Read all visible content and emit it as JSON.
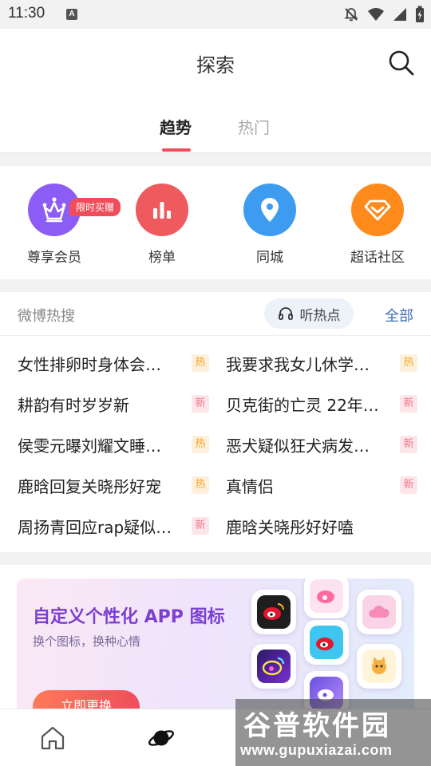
{
  "status_bar": {
    "time": "11:30",
    "notification_badge": "A",
    "icons": [
      "notifications-off-icon",
      "wifi-icon",
      "signal-icon",
      "battery-charging-icon"
    ]
  },
  "header": {
    "title": "探索",
    "search_icon": "search-icon"
  },
  "tabs": [
    {
      "label": "趋势",
      "active": true
    },
    {
      "label": "热门",
      "active": false
    }
  ],
  "quick_entries": [
    {
      "label": "尊享会员",
      "icon": "crown-icon",
      "color": "#8b5cf6",
      "badge": "限时买赠"
    },
    {
      "label": "榜单",
      "icon": "bar-chart-icon",
      "color": "#ef5a5f"
    },
    {
      "label": "同城",
      "icon": "location-pin-icon",
      "color": "#3d9cf0"
    },
    {
      "label": "超话社区",
      "icon": "diamond-icon",
      "color": "#ff8a1c"
    }
  ],
  "hot_search": {
    "title": "微博热搜",
    "listen_label": "听热点",
    "all_label": "全部",
    "items": [
      {
        "text": "女性排卵时身体会…",
        "tag": "热"
      },
      {
        "text": "我要求我女儿休学…",
        "tag": "热"
      },
      {
        "text": "耕韵有时岁岁新",
        "tag": "新"
      },
      {
        "text": "贝克街的亡灵 22年…",
        "tag": "新"
      },
      {
        "text": "侯雯元曝刘耀文睡…",
        "tag": "热"
      },
      {
        "text": "恶犬疑似狂犬病发…",
        "tag": "新"
      },
      {
        "text": "鹿晗回复关晓彤好宠",
        "tag": "热"
      },
      {
        "text": "真情侣",
        "tag": "新"
      },
      {
        "text": "周扬青回应rap疑似…",
        "tag": "新"
      },
      {
        "text": "鹿晗关晓彤好好嗑",
        "tag": ""
      }
    ]
  },
  "banner": {
    "title": "自定义个性化 APP 图标",
    "subtitle": "换个图标，换种心情",
    "button_label": "立即更换"
  },
  "bottom_nav": [
    {
      "icon": "home-icon",
      "active": false
    },
    {
      "icon": "planet-icon",
      "active": true
    }
  ],
  "watermark": {
    "title": "谷普软件园",
    "url": "www.gupuxiazai.com"
  },
  "colors": {
    "accent": "#ef4d5b",
    "link": "#3c6fb5",
    "tag_hot": "#f5a623",
    "tag_new": "#f2758a"
  }
}
